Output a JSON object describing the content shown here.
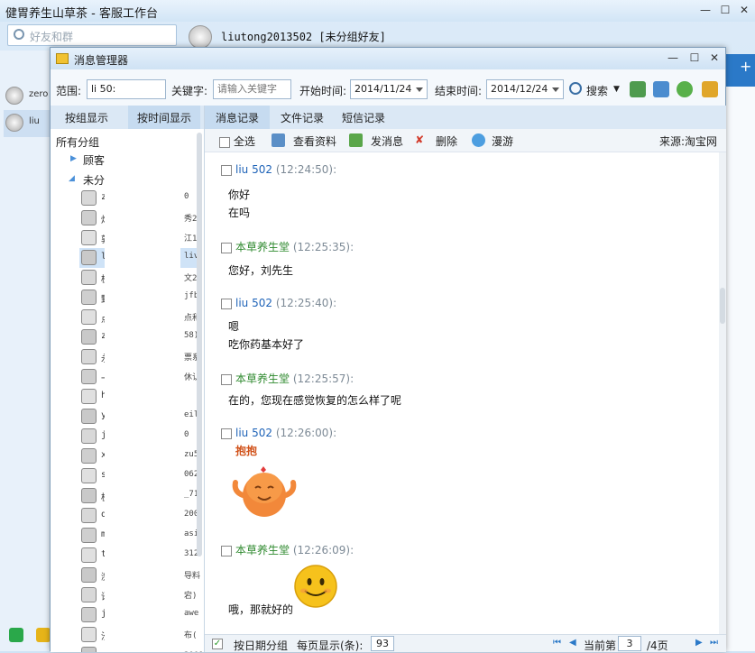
{
  "background_window": {
    "title": "健胃养生山草茶 - 客服工作台",
    "search_placeholder": "好友和群",
    "chat_contact_name": "liutong2013502 [未分组好友]",
    "list_items": [
      "zero",
      "liu"
    ]
  },
  "dialog": {
    "title": "消息管理器",
    "toolbar": {
      "scope_label": "范围:",
      "scope_value": "li            50:",
      "keyword_label": "关键字:",
      "keyword_placeholder": "请输入关键字",
      "start_label": "开始时间:",
      "start_value": "2014/11/24",
      "end_label": "结束时间:",
      "end_value": "2014/12/24",
      "search_label": "搜索"
    },
    "left_tabs": [
      "按组显示",
      "按时间显示"
    ],
    "tree": {
      "root": "所有分组",
      "group_customers": "顾客",
      "group_ungrouped": "未分组",
      "contacts": [
        {
          "name": "z",
          "right": "0"
        },
        {
          "name": "烟",
          "right": "秀2"
        },
        {
          "name": "敦",
          "right": "江1"
        },
        {
          "name": "l",
          "right": "liv"
        },
        {
          "name": "桂",
          "right": "文2"
        },
        {
          "name": "野",
          "right": "jfb"
        },
        {
          "name": "点",
          "right": "点和"
        },
        {
          "name": "z",
          "right": "58)"
        },
        {
          "name": "永",
          "right": "票系"
        },
        {
          "name": "一",
          "right": "休认"
        },
        {
          "name": "h",
          "right": ""
        },
        {
          "name": "y",
          "right": "eil"
        },
        {
          "name": "j",
          "right": "0"
        },
        {
          "name": "x",
          "right": "zu5"
        },
        {
          "name": "s",
          "right": "062"
        },
        {
          "name": "桂",
          "right": "_71"
        },
        {
          "name": "q",
          "right": "200"
        },
        {
          "name": "m",
          "right": "asi"
        },
        {
          "name": "t",
          "right": "312"
        },
        {
          "name": "濒",
          "right": "导料"
        },
        {
          "name": "语",
          "right": "宕)"
        },
        {
          "name": "j",
          "right": "awe"
        },
        {
          "name": "汐",
          "right": "布("
        },
        {
          "name": "奥山延",
          "right": "2009(奥山延"
        }
      ]
    },
    "right_tabs": [
      "消息记录",
      "文件记录",
      "短信记录"
    ],
    "actions": {
      "select_all": "全选",
      "view_profile": "查看资料",
      "send_message": "发消息",
      "delete": "删除",
      "roam": "漫游",
      "source": "来源:淘宝网"
    },
    "messages": [
      {
        "sender": "liu              502",
        "role": "customer",
        "time": "(12:24:50):",
        "lines": [
          "你好",
          "在吗"
        ]
      },
      {
        "sender": "本草养生堂",
        "role": "staff",
        "time": "(12:25:35):",
        "lines": [
          "您好，刘先生"
        ]
      },
      {
        "sender": "liu              502",
        "role": "customer",
        "time": "(12:25:40):",
        "lines": [
          "嗯",
          "吃你药基本好了"
        ]
      },
      {
        "sender": "本草养生堂",
        "role": "staff",
        "time": "(12:25:57):",
        "lines": [
          "在的，您现在感觉恢复的怎么样了呢"
        ]
      },
      {
        "sender": "liu              502",
        "role": "customer",
        "time": "(12:26:00):",
        "lines": [],
        "sticker": "hug-sticker",
        "sticker_text": "抱抱"
      },
      {
        "sender": "本草养生堂",
        "role": "staff",
        "time": "(12:26:09):",
        "lines": [
          "哦，那就好的"
        ],
        "sticker": "smile-emoji"
      }
    ],
    "footer": {
      "group_by_date": "按日期分组",
      "per_page_label": "每页显示(条):",
      "per_page_value": "93",
      "current_page_label": "当前第",
      "current_page": "3",
      "total_pages": "/4页"
    }
  },
  "colors": {
    "customer_name": "#1e63b8",
    "staff_name": "#2f8a2f",
    "time": "#7d8a96",
    "accent_blue": "#2b79c8"
  }
}
